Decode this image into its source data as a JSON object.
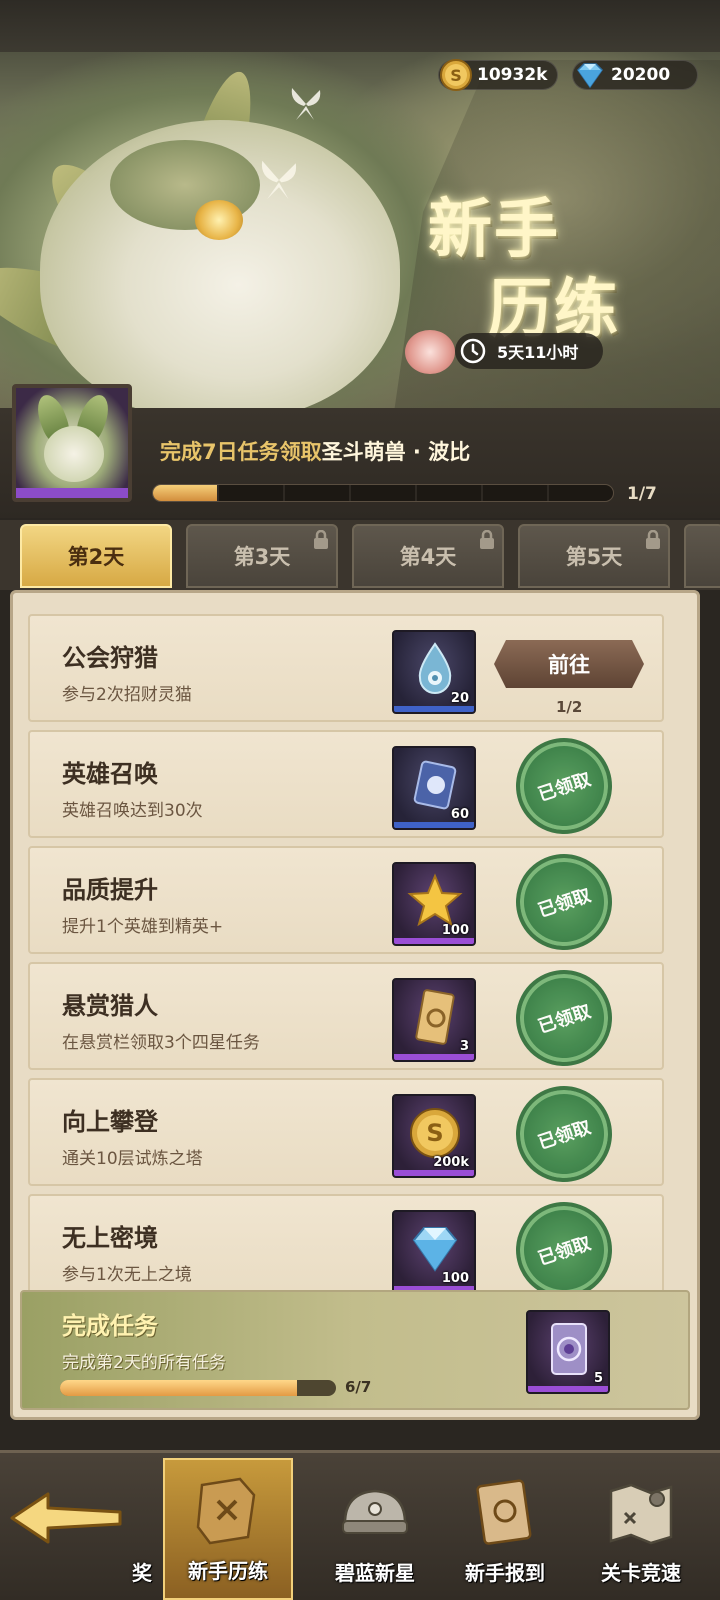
{
  "currency": {
    "gold": "10932k",
    "gems": "20200"
  },
  "event": {
    "title_line1": "新手",
    "title_line2": "历练",
    "timer": "5天11小时"
  },
  "reward": {
    "prefix": "完成7日任务领取",
    "hero_name": "圣斗萌兽 · 波比",
    "progress_text": "1/7",
    "progress_value": 0.14
  },
  "tabs": [
    {
      "label": "第2天",
      "active": true,
      "locked": false
    },
    {
      "label": "第3天",
      "active": false,
      "locked": true
    },
    {
      "label": "第4天",
      "active": false,
      "locked": true
    },
    {
      "label": "第5天",
      "active": false,
      "locked": true
    }
  ],
  "tasks": [
    {
      "name": "公会狩猎",
      "desc": "参与2次招财灵猫",
      "qty": "20",
      "state": "go",
      "button": "前往",
      "count": "1/2",
      "icon": "water-drop-icon"
    },
    {
      "name": "英雄召唤",
      "desc": "英雄召唤达到30次",
      "qty": "60",
      "state": "claimed",
      "stamp": "已领取",
      "icon": "summon-card-icon"
    },
    {
      "name": "品质提升",
      "desc": "提升1个英雄到精英+",
      "qty": "100",
      "state": "claimed",
      "stamp": "已领取",
      "icon": "star-icon"
    },
    {
      "name": "悬赏猎人",
      "desc": "在悬赏栏领取3个四星任务",
      "qty": "3",
      "state": "claimed",
      "stamp": "已领取",
      "icon": "scroll-ticket-icon"
    },
    {
      "name": "向上攀登",
      "desc": "通关10层试炼之塔",
      "qty": "200k",
      "state": "claimed",
      "stamp": "已领取",
      "icon": "gold-coin-icon"
    },
    {
      "name": "无上密境",
      "desc": "参与1次无上之境",
      "qty": "100",
      "state": "claimed",
      "stamp": "已领取",
      "icon": "diamond-icon"
    }
  ],
  "complete_task": {
    "title": "完成任务",
    "desc": "完成第2天的所有任务",
    "progress_text": "6/7",
    "progress_value": 0.857,
    "reward_qty": "5"
  },
  "nav": [
    {
      "label": "奖",
      "active": false
    },
    {
      "label": "新手历练",
      "active": true
    },
    {
      "label": "碧蓝新星",
      "active": false
    },
    {
      "label": "新手报到",
      "active": false
    },
    {
      "label": "关卡竞速",
      "active": false
    }
  ]
}
